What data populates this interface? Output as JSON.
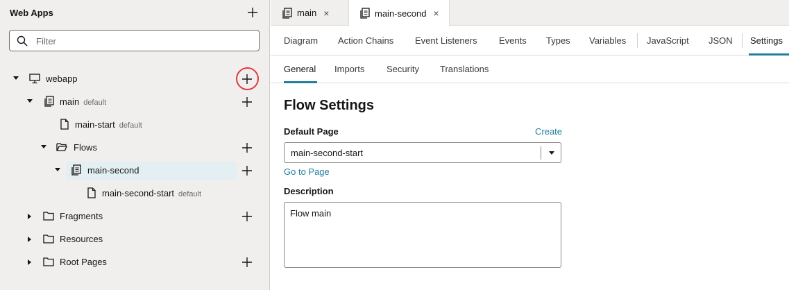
{
  "navigator": {
    "title": "Web Apps",
    "filter": {
      "placeholder": "Filter",
      "value": ""
    },
    "tree": [
      {
        "label": "webapp",
        "sub": ""
      },
      {
        "label": "main",
        "sub": "default"
      },
      {
        "label": "main-start",
        "sub": "default"
      },
      {
        "label": "Flows",
        "sub": ""
      },
      {
        "label": "main-second",
        "sub": ""
      },
      {
        "label": "main-second-start",
        "sub": "default"
      },
      {
        "label": "Fragments",
        "sub": ""
      },
      {
        "label": "Resources",
        "sub": ""
      },
      {
        "label": "Root Pages",
        "sub": ""
      }
    ]
  },
  "file_tabs": [
    {
      "label": "main",
      "close": "×"
    },
    {
      "label": "main-second",
      "close": "×"
    }
  ],
  "designer_tabs": [
    "Diagram",
    "Action Chains",
    "Event Listeners",
    "Events",
    "Types",
    "Variables",
    "JavaScript",
    "JSON",
    "Settings"
  ],
  "settings_tabs": [
    "General",
    "Imports",
    "Security",
    "Translations"
  ],
  "form": {
    "title": "Flow Settings",
    "default_page_label": "Default Page",
    "create_link": "Create",
    "default_page_value": "main-second-start",
    "goto_link": "Go to Page",
    "description_label": "Description",
    "description_value": "Flow main"
  },
  "colors": {
    "accent": "#227e9e",
    "highlight_ring": "#e0393e",
    "selected_row": "#e4eff3",
    "panel_bg": "#f1efed"
  }
}
